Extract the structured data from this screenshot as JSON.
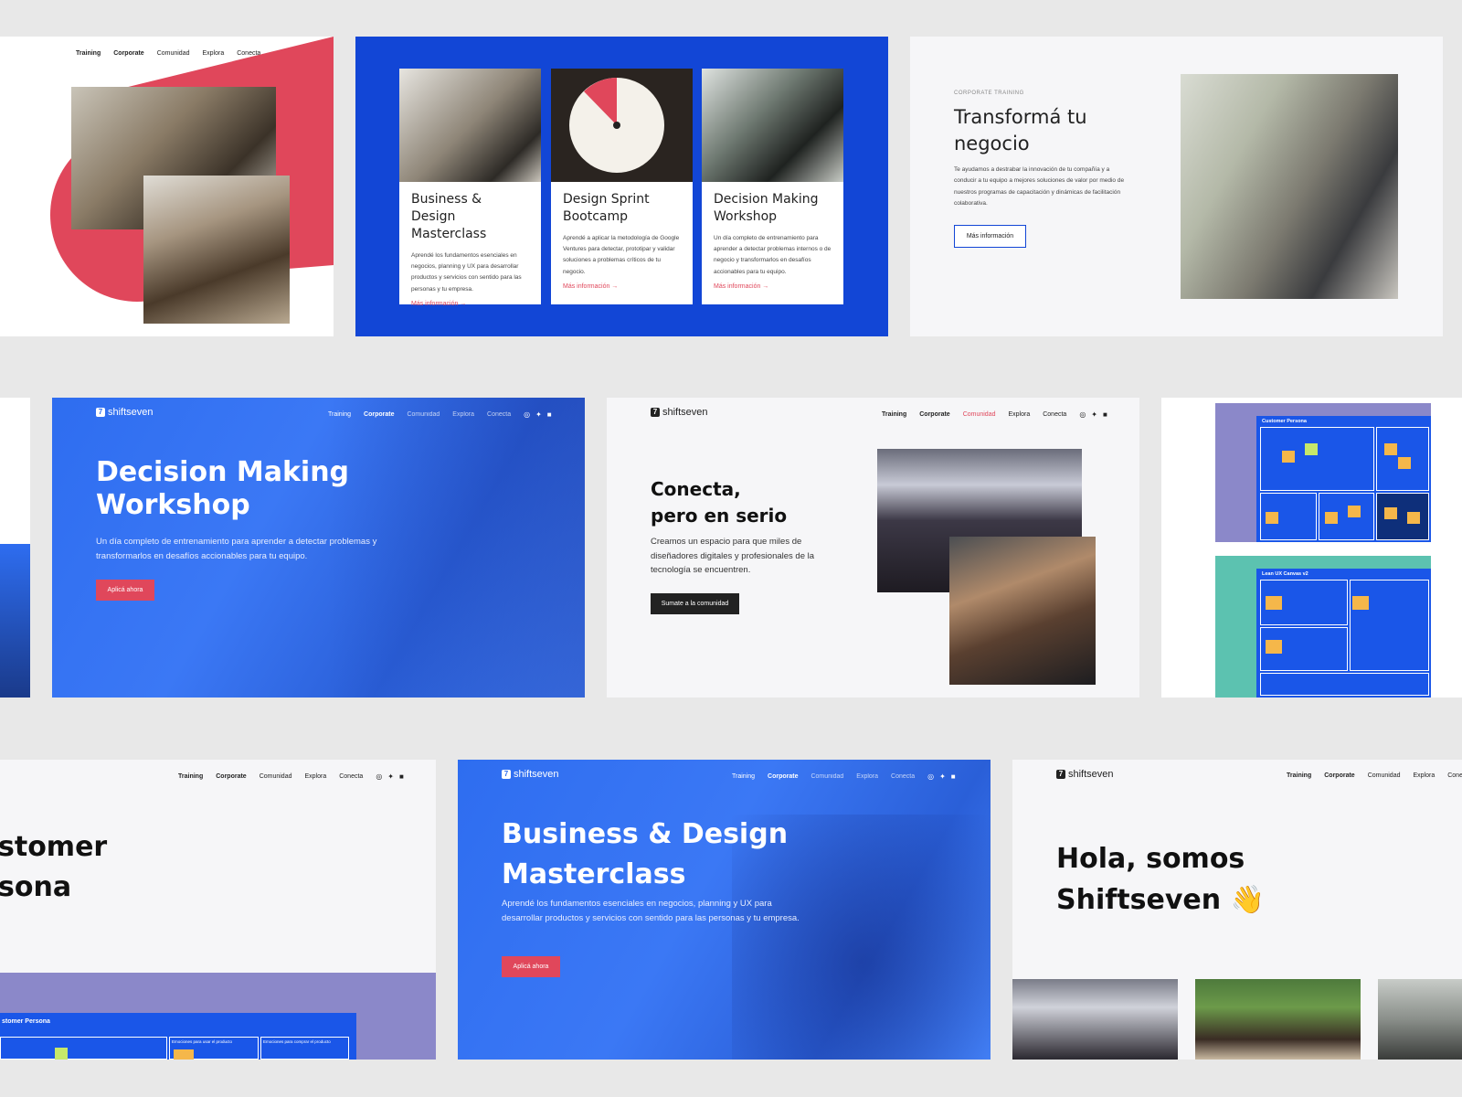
{
  "nav": {
    "items": [
      "Training",
      "Corporate",
      "Comunidad",
      "Explora",
      "Conecta"
    ],
    "social_icons": [
      "instagram-icon",
      "twitter-icon",
      "facebook-icon"
    ]
  },
  "brand": {
    "name": "shiftseven"
  },
  "colors": {
    "blue": "#1246d6",
    "hero_blue": "#2e6df0",
    "red": "#e0475b",
    "purple": "#8b88c9",
    "teal": "#5cc2b0",
    "gray_bg": "#e8e8e8"
  },
  "courses": [
    {
      "title": "Business & Design Masterclass",
      "desc": "Aprendé los fundamentos esenciales en negocios, planning y UX para desarrollar productos y servicios con sentido para las personas y tu empresa.",
      "more": "Más información →"
    },
    {
      "title": "Design Sprint Bootcamp",
      "desc": "Aprendé a aplicar la metodología de Google Ventures para detectar, prototipar y validar soluciones a problemas críticos de tu negocio.",
      "more": "Más información →"
    },
    {
      "title": "Decision Making Workshop",
      "desc": "Un día completo de entrenamiento para aprender a detectar problemas internos o de negocio y transformarlos en desafíos accionables para tu equipo.",
      "more": "Más información →"
    }
  ],
  "corporate": {
    "eyebrow": "CORPORATE TRAINING",
    "title": "Transformá tu negocio",
    "desc": "Te ayudamos a destrabar la innovación de tu compañía y a conducir a tu equipo a mejores soluciones de valor por medio de nuestros programas de capacitación y dinámicas de facilitación colaborativa.",
    "button": "Más información"
  },
  "decision": {
    "title_line1": "Decision Making",
    "title_line2": "Workshop",
    "desc": "Un día completo de entrenamiento para aprender a detectar problemas y transformarlos en desafíos accionables para tu equipo.",
    "button": "Aplicá ahora"
  },
  "conecta": {
    "title_line1": "Conecta,",
    "title_line2": "pero en serio",
    "desc": "Creamos un espacio para que miles de diseñadores digitales y profesionales de la tecnología se encuentren.",
    "button": "Sumate a la comunidad"
  },
  "canvases": {
    "persona_title": "Customer Persona",
    "lean_title": "Lean UX Canvas v2"
  },
  "persona_partial": {
    "title_line1": "stomer",
    "title_line2": "sona",
    "board_title": "stomer Persona",
    "col1": "Emociones para usar el producto",
    "col2": "Emociones para comprar el producto"
  },
  "masterclass": {
    "title_line1": "Business & Design",
    "title_line2": "Masterclass",
    "desc": "Aprendé los fundamentos esenciales en negocios, planning y UX para desarrollar productos y servicios con sentido para las personas y tu empresa.",
    "button": "Aplicá ahora"
  },
  "hola": {
    "title_line1": "Hola, somos",
    "title_line2": "Shiftseven",
    "emoji": "👋"
  }
}
